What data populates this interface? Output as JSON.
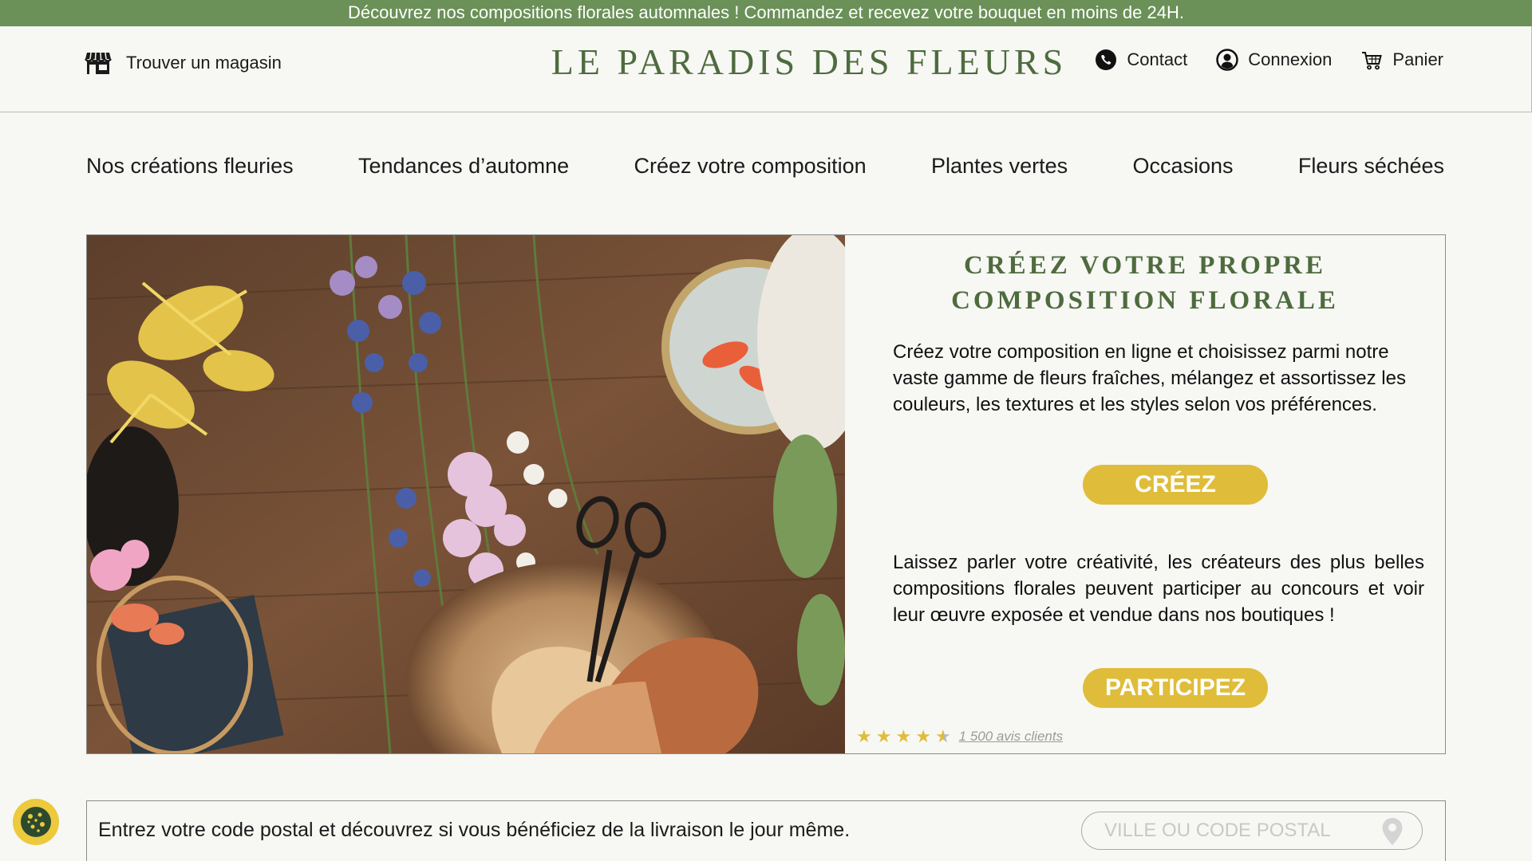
{
  "banner": {
    "text": "Découvrez nos compositions florales automnales ! Commandez et recevez votre bouquet en moins de 24H."
  },
  "header": {
    "store_locator": "Trouver un magasin",
    "brand": "LE PARADIS DES FLEURS",
    "actions": [
      {
        "label": "Contact",
        "icon": "phone-icon"
      },
      {
        "label": "Connexion",
        "icon": "user-icon"
      },
      {
        "label": "Panier",
        "icon": "cart-icon"
      }
    ]
  },
  "nav": {
    "items": [
      "Nos créations fleuries",
      "Tendances d’automne",
      "Créez votre composition",
      "Plantes vertes",
      "Occasions",
      "Fleurs séchées"
    ]
  },
  "hero": {
    "image_alt": "flower-arrangement-photo",
    "title": "CRÉEZ VOTRE PROPRE COMPOSITION FLORALE",
    "text1": "Créez votre composition en ligne et choisissez parmi notre vaste gamme de fleurs fraîches, mélangez et assortissez les couleurs, les textures et les styles selon vos préférences.",
    "cta1": "CRÉEZ",
    "text2": "Laissez parler votre créativité, les créateurs des plus belles compositions florales peuvent participer au concours et voir leur œuvre exposée et vendue dans nos boutiques !",
    "cta2": "PARTICIPEZ",
    "rating": {
      "stars": 4.5,
      "max": 5,
      "reviews_label": "1 500 avis clients"
    }
  },
  "delivery": {
    "text": "Entrez votre code postal et découvrez si vous bénéficiez de la livraison le jour même.",
    "placeholder": "VILLE OU CODE POSTAL",
    "value": ""
  },
  "colors": {
    "banner_green": "#6b9058",
    "brand_green": "#4e6b3e",
    "cta_yellow": "#dfbd3a",
    "background": "#f7f7f4"
  }
}
